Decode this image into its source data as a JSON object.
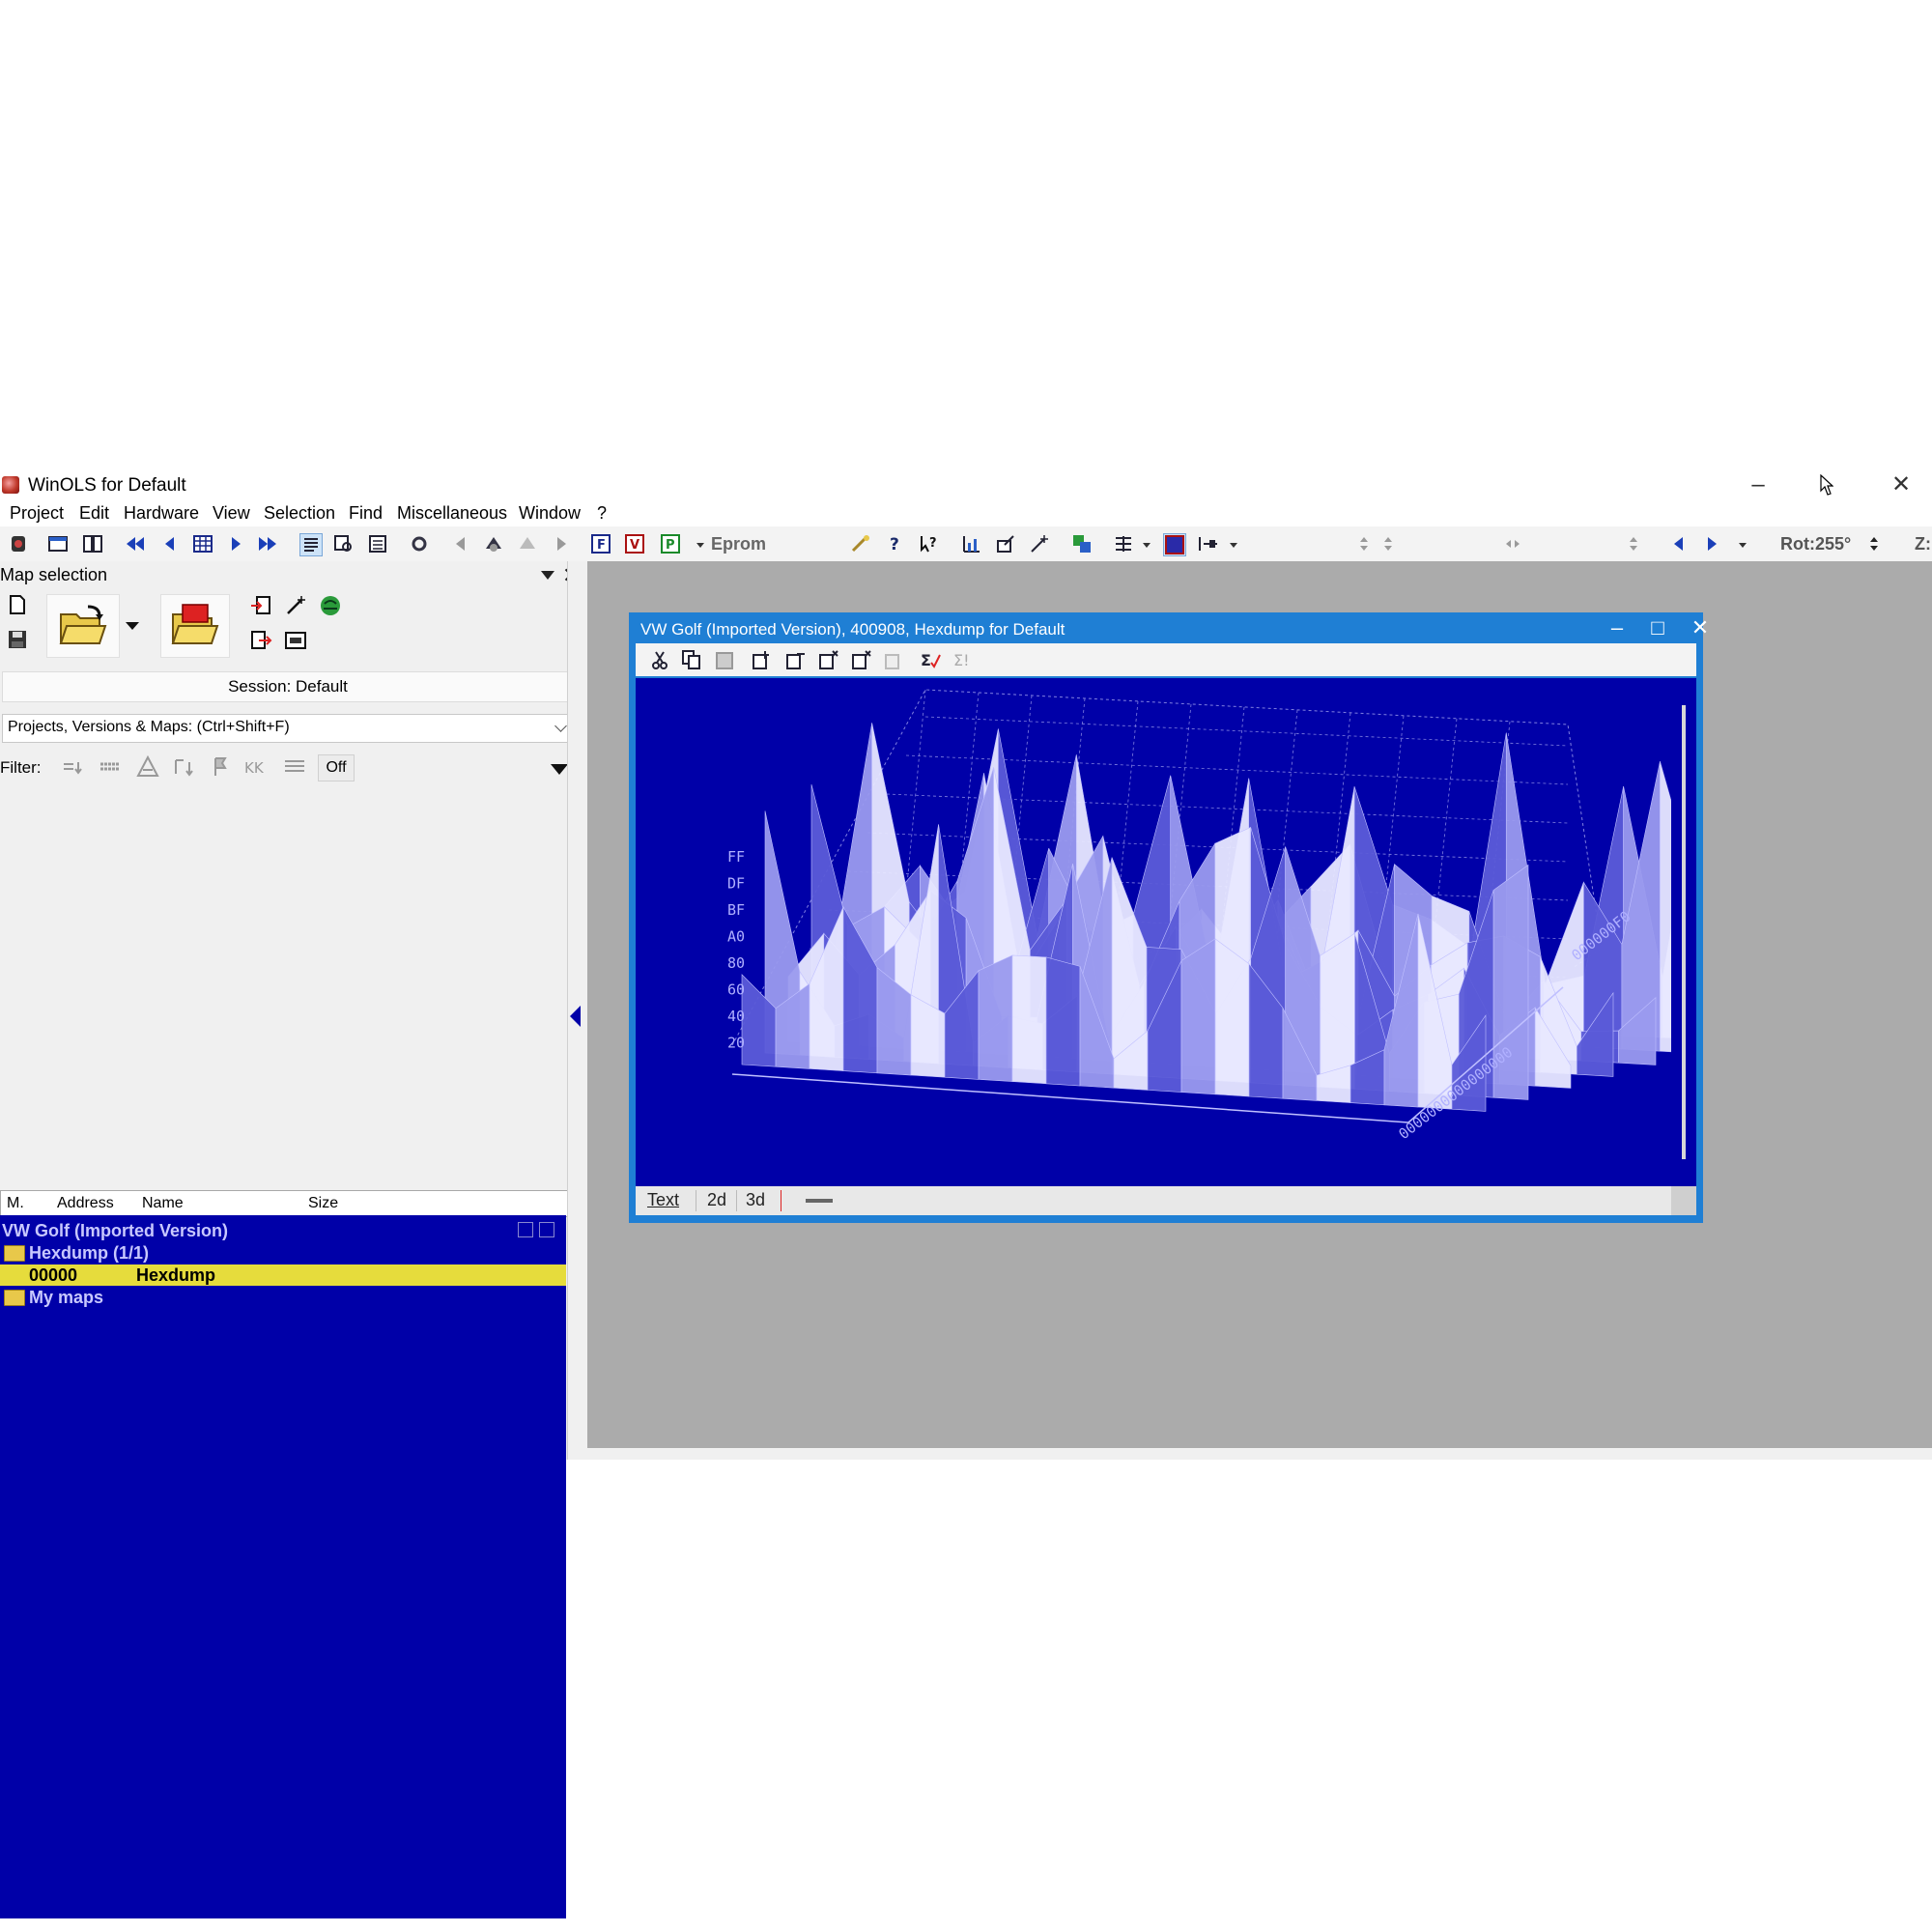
{
  "app": {
    "title": "WinOLS for Default",
    "minimize": "–",
    "close": "✕"
  },
  "menu": [
    "Project",
    "Edit",
    "Hardware",
    "View",
    "Selection",
    "Find",
    "Miscellaneous",
    "Window",
    "?"
  ],
  "toolbar": {
    "eprom_label": "Eprom",
    "rotation_label": "Rot:255°",
    "z_label": "Z:"
  },
  "map_selection": {
    "title": "Map selection",
    "session": "Session: Default",
    "search_placeholder": "Projects, Versions & Maps:  (Ctrl+Shift+F)",
    "filter_label": "Filter:",
    "filter_off": "Off",
    "columns": [
      "M.",
      "Address",
      "Name",
      "Size"
    ],
    "tree": {
      "project": "VW Golf (Imported Version)",
      "folder": "Hexdump (1/1)",
      "row_address": "00000",
      "row_name": "Hexdump",
      "my_maps": "My maps"
    }
  },
  "child_window": {
    "title": "VW Golf (Imported Version), 400908, Hexdump for Default",
    "minimize": "–",
    "maximize": "□",
    "close": "✕",
    "tabs": [
      "Text",
      "2d",
      "3d"
    ]
  },
  "plot_3d": {
    "y_tick_labels": [
      "FF",
      "DF",
      "BF",
      "A0",
      "80",
      "60",
      "40",
      "20"
    ],
    "axis_label_right": "000000F0",
    "axis_labels_bottom": "0000000000000000",
    "background": "#0000a8",
    "surface_light": "#e8e8ff",
    "surface_dark": "#5b5bd8",
    "grid_color": "#8080e0"
  },
  "colors": {
    "tree_background": "#0000a8",
    "selected_row": "#e6dc3c",
    "child_frame": "#1f7fd4",
    "mdi_background": "#ababab"
  }
}
